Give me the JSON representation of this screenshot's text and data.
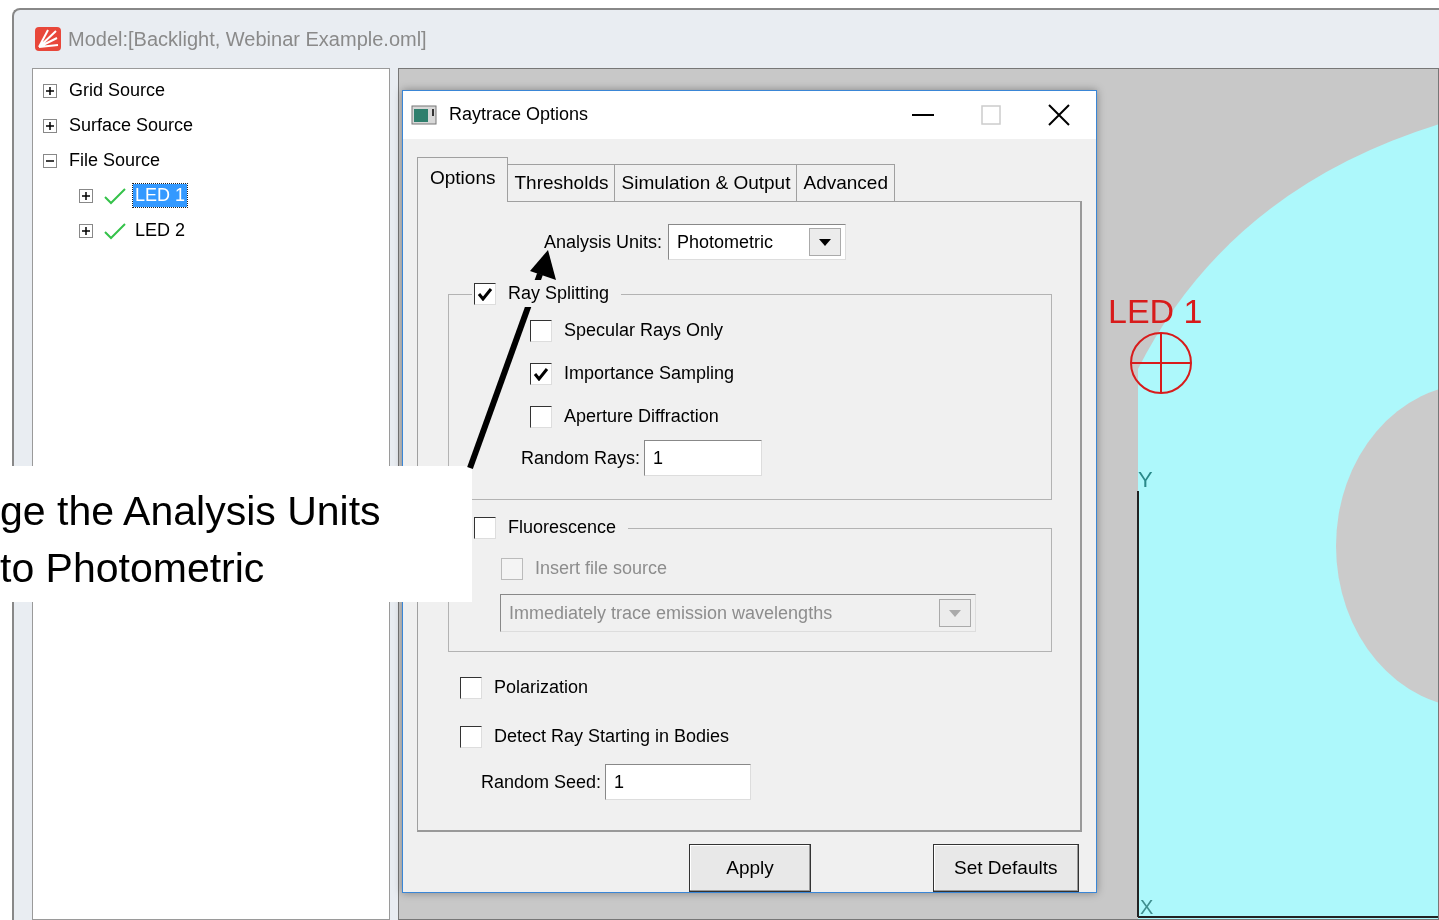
{
  "window": {
    "title": "Model:[Backlight, Webinar Example.oml]"
  },
  "tree": [
    {
      "label": "Grid Source",
      "expanded": false,
      "selected": false
    },
    {
      "label": "Surface Source",
      "expanded": false,
      "selected": false
    },
    {
      "label": "File Source",
      "expanded": true,
      "selected": false,
      "children": [
        {
          "label": "LED 1",
          "expanded": false,
          "checked": true,
          "selected": true
        },
        {
          "label": "LED 2",
          "expanded": false,
          "checked": true,
          "selected": false
        }
      ]
    }
  ],
  "viewport": {
    "source_label": "LED 1",
    "axis_labels": [
      "Y",
      "X"
    ]
  },
  "dialog": {
    "title": "Raytrace Options",
    "tabs": [
      {
        "label": "Options",
        "selected": true
      },
      {
        "label": "Thresholds",
        "selected": false
      },
      {
        "label": "Simulation & Output",
        "selected": false
      },
      {
        "label": "Advanced",
        "selected": false
      }
    ],
    "analysis_units": {
      "label": "Analysis Units:",
      "value": "Photometric"
    },
    "ray_splitting": {
      "label": "Ray Splitting",
      "checked": true,
      "options": [
        {
          "label": "Specular Rays Only",
          "checked": false
        },
        {
          "label": "Importance Sampling",
          "checked": true
        },
        {
          "label": "Aperture Diffraction",
          "checked": false
        }
      ],
      "random_rays": {
        "label": "Random Rays:",
        "value": "1"
      }
    },
    "fluorescence": {
      "label": "Fluorescence",
      "checked": false,
      "insert_file_source": {
        "label": "Insert file source",
        "checked": false,
        "disabled": true
      },
      "mode": {
        "value": "Immediately trace emission wavelengths",
        "disabled": true
      }
    },
    "options": [
      {
        "label": "Polarization",
        "checked": false
      },
      {
        "label": "Detect Ray Starting in Bodies",
        "checked": false
      }
    ],
    "random_seed": {
      "label": "Random Seed:",
      "value": "1"
    },
    "buttons": [
      "Apply",
      "Set Defaults"
    ]
  },
  "callout": {
    "lines": [
      "ge the Analysis Units",
      "to Photometric"
    ]
  }
}
